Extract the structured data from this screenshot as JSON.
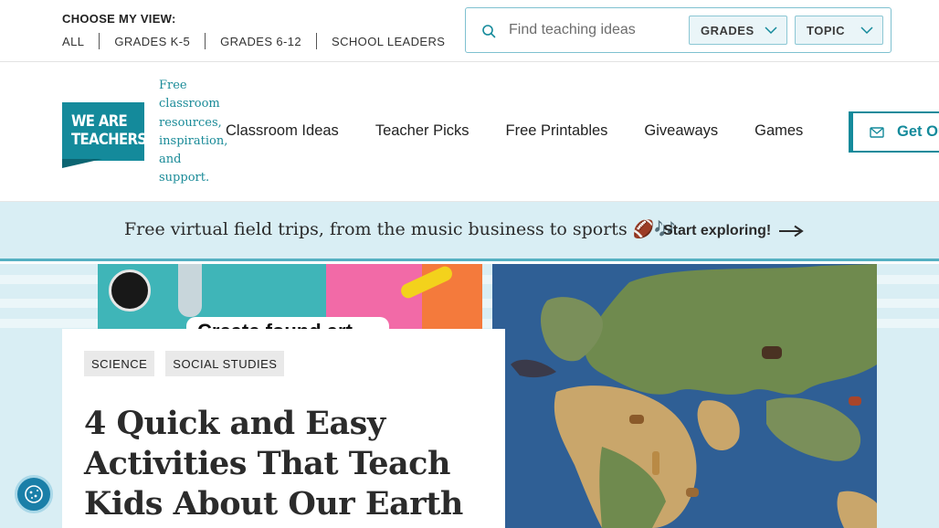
{
  "view_selector": {
    "title": "CHOOSE MY VIEW:",
    "links": [
      "ALL",
      "GRADES K-5",
      "GRADES 6-12",
      "SCHOOL LEADERS"
    ]
  },
  "search": {
    "placeholder": "Find teaching ideas",
    "icon": "search-icon",
    "grades_label": "GRADES",
    "topic_label": "TOPIC"
  },
  "brand": {
    "logo_line1": "WE ARE",
    "logo_line2": "TEACHERS",
    "tagline": "Free classroom resources, inspiration, and support.",
    "color": "#148a9b"
  },
  "nav": {
    "items": [
      "Classroom Ideas",
      "Teacher Picks",
      "Free Printables",
      "Giveaways",
      "Games"
    ],
    "cta_label": "Get Our"
  },
  "banner": {
    "text": "Free virtual field trips, from the music business to sports 🏈🎶",
    "link": "Start exploring!"
  },
  "hero": {
    "image_caption": "Create found art",
    "tags": [
      "SCIENCE",
      "SOCIAL STUDIES"
    ],
    "headline": "4 Quick and Easy Activities That Teach Kids About Our Earth"
  },
  "colors": {
    "accent": "#148a9b",
    "banner_bg": "#d9eef4",
    "banner_border": "#54b0c2"
  }
}
